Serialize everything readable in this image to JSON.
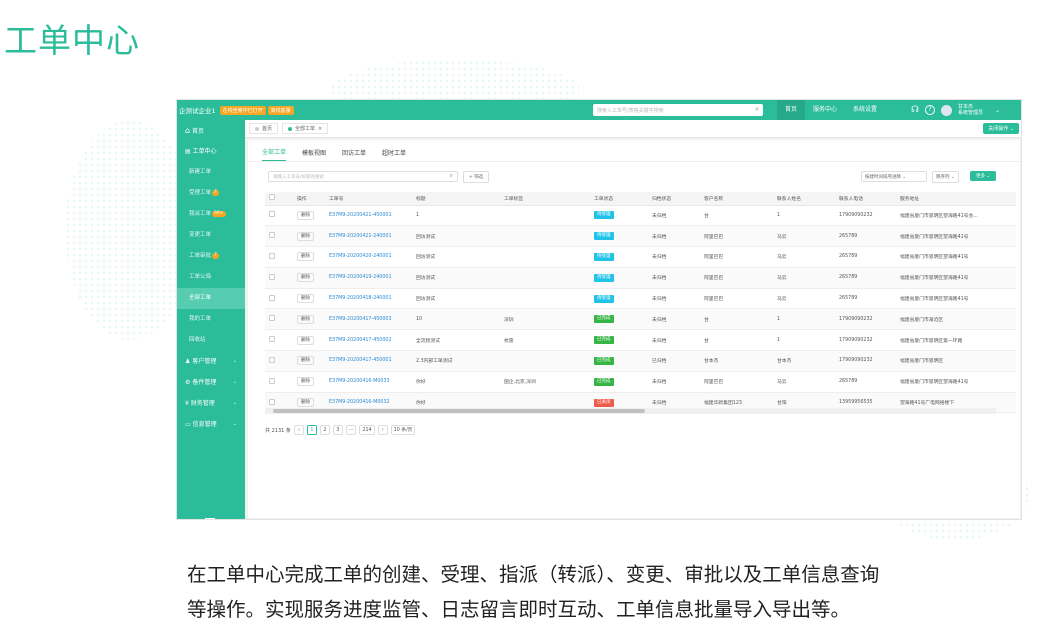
{
  "heading": "工单中心",
  "description": {
    "line1": "在工单中心完成工单的创建、受理、指派（转派）、变更、审批以及工单信息查询",
    "line2": "等操作。实现服务进度监管、日志留言即时互动、工单信息批量导入导出等。"
  },
  "colors": {
    "accent": "#2bbc9a",
    "link": "#2a8ad5",
    "pending": "#1fc3e8",
    "done": "#34b544",
    "closed": "#ee5b4b",
    "badge": "#f5a623"
  },
  "topbar": {
    "company": "企测试企业1",
    "badge1": "在线坐席中已打开",
    "badge2": "离线客服",
    "search_placeholder": "搜索入工单号/表格关键字搜索",
    "nav": [
      "首页",
      "服务中心",
      "系统设置"
    ],
    "active_nav": "首页",
    "user_name": "甘本杰",
    "user_role": "系统管理员"
  },
  "sidebar": {
    "home": "首页",
    "workorder_center": "工单中心",
    "sub_items": [
      {
        "label": "新建工单",
        "badge": ""
      },
      {
        "label": "受理工单",
        "badge": "7"
      },
      {
        "label": "我派工单",
        "badge": "99+"
      },
      {
        "label": "变更工单",
        "badge": ""
      },
      {
        "label": "工单审批",
        "badge": "7"
      },
      {
        "label": "工单公海",
        "badge": ""
      },
      {
        "label": "全部工单",
        "badge": "",
        "active": true
      },
      {
        "label": "我的工单",
        "badge": ""
      },
      {
        "label": "回收站",
        "badge": ""
      }
    ],
    "groups": [
      "客户管理",
      "备件管理",
      "财务管理",
      "信息管理"
    ]
  },
  "page_tabs": {
    "tab1": "首页",
    "tab2": "全部工单",
    "close_label": "关闭操作"
  },
  "sub_tabs": [
    "全部工单",
    "模板视图",
    "回访工单",
    "超时工单"
  ],
  "filter": {
    "search_placeholder": "请输入工单号/标题的搜索",
    "filter_label": "筛选",
    "time_select": "按建时间排序进降",
    "sort_label": "降序列",
    "more_label": "更多"
  },
  "table": {
    "columns": [
      "",
      "操作",
      "工单号",
      "标题",
      "工单标签",
      "工单状态",
      "归档状态",
      "客户名称",
      "联系人姓名",
      "联系人电话",
      "服务地址"
    ],
    "rows": [
      {
        "op": "删除",
        "no": "E37M9-20200421-450001",
        "title": "1",
        "tag": "",
        "status": "待受理",
        "status_type": "pending",
        "archive": "未归档",
        "customer": "甘",
        "contact": "1",
        "phone": "17909090232",
        "address": "福建省厦门市思明区望海路41号会..."
      },
      {
        "op": "删除",
        "no": "E37M9-20200421-240001",
        "title": "回访测试",
        "tag": "",
        "status": "待受理",
        "status_type": "pending",
        "archive": "未归档",
        "customer": "阿里巴巴",
        "contact": "马云",
        "phone": "265789",
        "address": "福建省厦门市思明区望海路41号"
      },
      {
        "op": "删除",
        "no": "E37M9-20200420-240001",
        "title": "回访测试",
        "tag": "",
        "status": "待受理",
        "status_type": "pending",
        "archive": "未归档",
        "customer": "阿里巴巴",
        "contact": "马云",
        "phone": "265789",
        "address": "福建省厦门市思明区望海路41号"
      },
      {
        "op": "删除",
        "no": "E37M9-20200419-240001",
        "title": "回访测试",
        "tag": "",
        "status": "待受理",
        "status_type": "pending",
        "archive": "未归档",
        "customer": "阿里巴巴",
        "contact": "马云",
        "phone": "265789",
        "address": "福建省厦门市思明区望海路41号"
      },
      {
        "op": "删除",
        "no": "E37M9-20200418-240001",
        "title": "回访测试",
        "tag": "",
        "status": "待受理",
        "status_type": "pending",
        "archive": "未归档",
        "customer": "阿里巴巴",
        "contact": "马云",
        "phone": "265789",
        "address": "福建省厦门市思明区望海路41号"
      },
      {
        "op": "删除",
        "no": "E37M9-20200417-450003",
        "title": "10",
        "tag": "深圳",
        "status": "已完成",
        "status_type": "done",
        "archive": "未归档",
        "customer": "甘",
        "contact": "1",
        "phone": "17909090232",
        "address": "福建省厦门市海沧区"
      },
      {
        "op": "删除",
        "no": "E37M9-20200417-450002",
        "title": "全流程测试",
        "tag": "杭雷",
        "status": "已完成",
        "status_type": "done",
        "archive": "未归档",
        "customer": "甘",
        "contact": "1",
        "phone": "17909090232",
        "address": "福建省厦门市思明区第一环路"
      },
      {
        "op": "删除",
        "no": "E37M9-20200417-450001",
        "title": "2.3内部工单测试",
        "tag": "",
        "status": "已完成",
        "status_type": "done",
        "archive": "已归档",
        "customer": "甘本杰",
        "contact": "甘本杰",
        "phone": "17909090232",
        "address": "福建省厦门市思明区"
      },
      {
        "op": "删除",
        "no": "E37M9-20200416-M0033",
        "title": "你好",
        "tag": "国企,北京,深圳",
        "status": "已完成",
        "status_type": "done",
        "archive": "未归档",
        "customer": "阿里巴巴",
        "contact": "马云",
        "phone": "265789",
        "address": "福建省厦门市思明区望海路41号"
      },
      {
        "op": "删除",
        "no": "E37M9-20200416-M0032",
        "title": "你好",
        "tag": "",
        "status": "已关闭",
        "status_type": "closed",
        "archive": "未归档",
        "customer": "福建华新集团123",
        "contact": "甘阳",
        "phone": "13959956535",
        "address": "望海路41号广电网络楼下"
      }
    ]
  },
  "pager": {
    "total": "共 2131 条",
    "pages": [
      "1",
      "2",
      "3",
      "···",
      "214"
    ],
    "prev": "‹",
    "next": "›",
    "page_size": "10 条/页"
  }
}
